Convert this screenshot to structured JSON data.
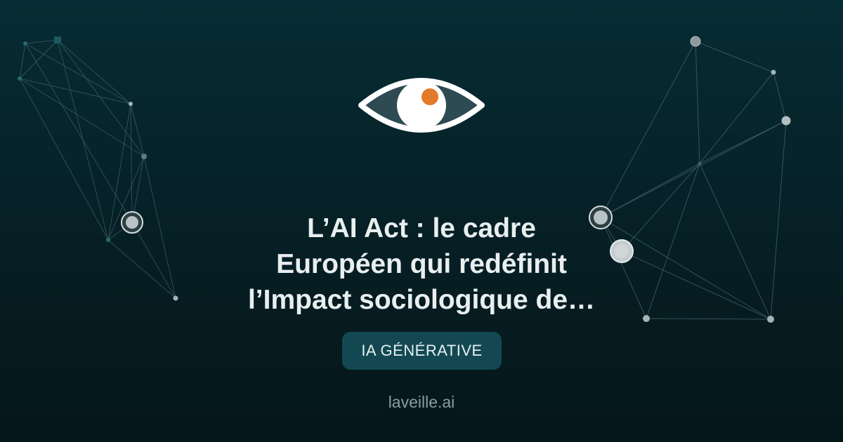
{
  "brand": {
    "logo_icon": "eye-icon",
    "accent_color": "#e37a2a",
    "site": "laveille.ai"
  },
  "article": {
    "title_lines": [
      "L’AI Act : le cadre",
      "Européen qui redéfinit",
      "l’Impact sociologique de…"
    ],
    "category": "IA GÉNÉRATIVE"
  },
  "colors": {
    "background": "#06252b",
    "badge": "#134852",
    "title": "#e9eeef",
    "network_lines": "#5f7f85"
  }
}
